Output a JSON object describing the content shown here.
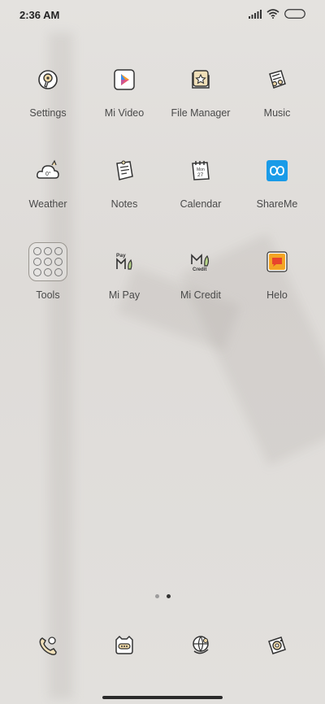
{
  "status_bar": {
    "time": "2:36 AM"
  },
  "apps": [
    {
      "label": "Settings",
      "icon": "settings-icon"
    },
    {
      "label": "Mi Video",
      "icon": "mi-video-icon"
    },
    {
      "label": "File Manager",
      "icon": "file-manager-icon"
    },
    {
      "label": "Music",
      "icon": "music-icon"
    },
    {
      "label": "Weather",
      "icon": "weather-icon"
    },
    {
      "label": "Notes",
      "icon": "notes-icon"
    },
    {
      "label": "Calendar",
      "icon": "calendar-icon",
      "icon_text": {
        "month": "Mon",
        "day": "27"
      }
    },
    {
      "label": "ShareMe",
      "icon": "shareme-icon"
    },
    {
      "label": "Tools",
      "icon": "tools-folder-icon"
    },
    {
      "label": "Mi Pay",
      "icon": "mi-pay-icon",
      "icon_text": "Pay"
    },
    {
      "label": "Mi Credit",
      "icon": "mi-credit-icon",
      "icon_text": "Credit"
    },
    {
      "label": "Helo",
      "icon": "helo-icon"
    }
  ],
  "page_indicator": {
    "pages": 2,
    "current": 2
  },
  "dock": [
    {
      "icon": "phone-dock-icon"
    },
    {
      "icon": "messages-dock-icon"
    },
    {
      "icon": "browser-dock-icon"
    },
    {
      "icon": "camera-dock-icon"
    }
  ],
  "colors": {
    "accent_blue": "#1a9be8",
    "mivideo_orange": "#f59b2a",
    "helo_red": "#e8452c",
    "line_art": "#333333"
  }
}
